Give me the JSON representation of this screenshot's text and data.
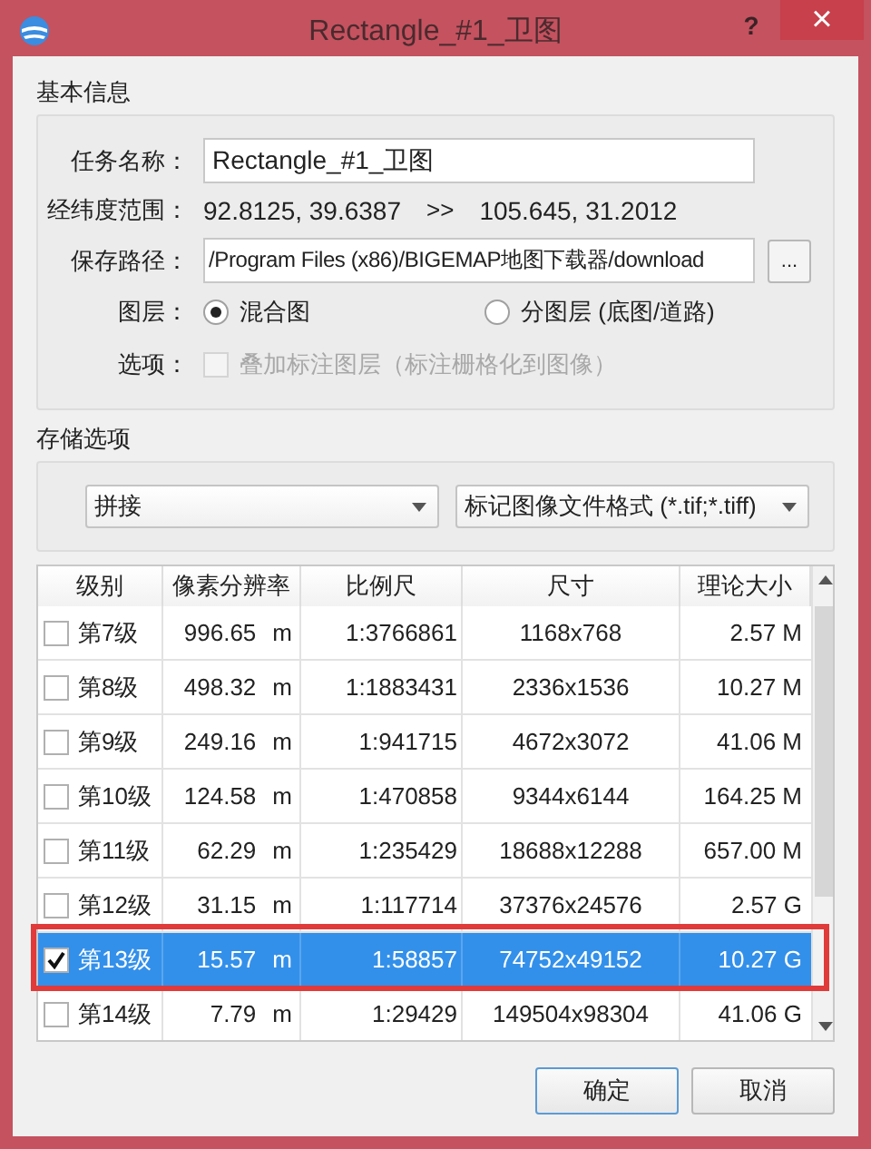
{
  "window": {
    "title": "Rectangle_#1_卫图",
    "help": "?",
    "close": "×"
  },
  "basic_info": {
    "title": "基本信息",
    "task_name": {
      "label": "任务名称：",
      "value": "Rectangle_#1_卫图"
    },
    "range": {
      "label": "经纬度范围：",
      "from": "92.8125, 39.6387",
      "arrow": ">>",
      "to": "105.645, 31.2012"
    },
    "save_path": {
      "label": "保存路径：",
      "value": "/Program Files (x86)/BIGEMAP地图下载器/download",
      "browse": "..."
    },
    "layer": {
      "label": "图层：",
      "options": [
        {
          "label": "混合图",
          "selected": true
        },
        {
          "label": "分图层 (底图/道路)",
          "selected": false
        }
      ]
    },
    "options": {
      "label": "选项：",
      "checkbox": {
        "label": "叠加标注图层（标注栅格化到图像）",
        "checked": false,
        "disabled": true
      }
    }
  },
  "storage": {
    "title": "存储选项",
    "dropdowns": [
      {
        "value": "拼接"
      },
      {
        "value": "标记图像文件格式 (*.tif;*.tiff)"
      }
    ]
  },
  "table": {
    "columns": [
      "级别",
      "像素分辨率",
      "比例尺",
      "尺寸",
      "理论大小"
    ],
    "rows": [
      {
        "level": "第7级",
        "resolution": "996.65",
        "unit": "m",
        "scale": "1:3766861",
        "size": "1168x768",
        "estimate": "2.57 M",
        "checked": false,
        "selected": false,
        "highlighted": false
      },
      {
        "level": "第8级",
        "resolution": "498.32",
        "unit": "m",
        "scale": "1:1883431",
        "size": "2336x1536",
        "estimate": "10.27 M",
        "checked": false,
        "selected": false,
        "highlighted": false
      },
      {
        "level": "第9级",
        "resolution": "249.16",
        "unit": "m",
        "scale": "1:941715",
        "size": "4672x3072",
        "estimate": "41.06 M",
        "checked": false,
        "selected": false,
        "highlighted": false
      },
      {
        "level": "第10级",
        "resolution": "124.58",
        "unit": "m",
        "scale": "1:470858",
        "size": "9344x6144",
        "estimate": "164.25 M",
        "checked": false,
        "selected": false,
        "highlighted": false
      },
      {
        "level": "第11级",
        "resolution": "62.29",
        "unit": "m",
        "scale": "1:235429",
        "size": "18688x12288",
        "estimate": "657.00 M",
        "checked": false,
        "selected": false,
        "highlighted": false
      },
      {
        "level": "第12级",
        "resolution": "31.15",
        "unit": "m",
        "scale": "1:117714",
        "size": "37376x24576",
        "estimate": "2.57 G",
        "checked": false,
        "selected": false,
        "highlighted": false
      },
      {
        "level": "第13级",
        "resolution": "15.57",
        "unit": "m",
        "scale": "1:58857",
        "size": "74752x49152",
        "estimate": "10.27 G",
        "checked": true,
        "selected": true,
        "highlighted": true
      },
      {
        "level": "第14级",
        "resolution": "7.79",
        "unit": "m",
        "scale": "1:29429",
        "size": "149504x98304",
        "estimate": "41.06 G",
        "checked": false,
        "selected": false,
        "highlighted": false
      }
    ]
  },
  "buttons": [
    "确定",
    "取消"
  ]
}
